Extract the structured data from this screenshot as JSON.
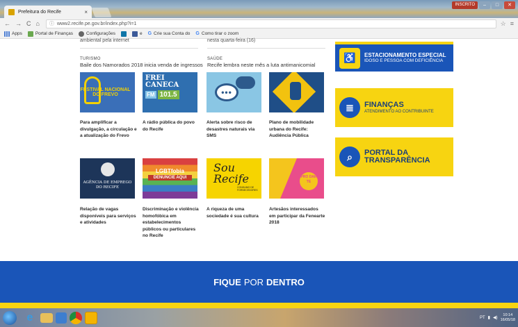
{
  "browser": {
    "tab_title": "Prefeitura do Recife",
    "tab_close": "×",
    "user_label": "INSCRITO",
    "nav_back": "←",
    "nav_forward": "→",
    "nav_reload": "C",
    "nav_home": "⌂",
    "url": "www2.recife.pe.gov.br/index.php?i=1",
    "info_glyph": "ⓘ",
    "star_glyph": "☆",
    "menu_glyph": "≡"
  },
  "bookmarks": [
    {
      "label": "Apps"
    },
    {
      "label": "Portal de Finanças"
    },
    {
      "label": "Configurações"
    },
    {
      "label": "in"
    },
    {
      "label": "e"
    },
    {
      "label": "Crie sua Conta do"
    },
    {
      "label": "Como tirar o zoom"
    }
  ],
  "page": {
    "cutoff_left": "ambiental pela internet",
    "cutoff_mid": "nesta quarta-feira (16)",
    "sections": [
      {
        "category": "TURISMO",
        "title": "Baile dos Namorados 2018 inicia venda de ingressos"
      },
      {
        "category": "SAÚDE",
        "title": "Recife lembra neste mês a luta antimanicomial"
      }
    ],
    "cards": [
      {
        "caption": "Para amplificar a divulgação, a circulação e a atualização do Frevo",
        "img_text": "FESTIVAL NACIONAL DO FREVO"
      },
      {
        "caption": "A rádio pública do povo do Recife",
        "img_t1": "FREI",
        "img_t2": "CANECA",
        "img_fm": "FM",
        "img_freq": "101.5"
      },
      {
        "caption": "Alerta sobre risco de desastres naturais via SMS",
        "img_text": "•••"
      },
      {
        "caption": "Plano de mobilidade urbana do Recife: Audiência Pública"
      },
      {
        "caption": "Relação de vagas disponíveis para serviços e atividades",
        "img_text": "AGÊNCIA DE EMPREGO DO RECIFE"
      },
      {
        "caption": "Discriminação e violência homofóbica em estabelecimentos públicos ou particulares no Recife",
        "img_t1": "LGBTfobia",
        "img_t2": "DENUNCIE AQUI"
      },
      {
        "caption": "A riqueza de uma sociedade é sua cultura",
        "img_t1": "Sou",
        "img_t2": "Recife",
        "img_sub": "CONSUMO DE FORNECEDORES"
      },
      {
        "caption": "Artesãos interessados em participar da Fenearte 2018",
        "img_text": "PRO DAR TE"
      }
    ],
    "banners": [
      {
        "title": "ESTACIONAMENTO ESPECIAL",
        "subtitle": "IDOSO E PESSOA COM DEFICIÊNCIA",
        "icon": "wheelchair-icon",
        "icon_glyph": "♿"
      },
      {
        "title": "FINANÇAS",
        "subtitle": "ATENDIMENTO AO CONTRIBUINTE",
        "icon": "coins-icon",
        "icon_glyph": "≣"
      },
      {
        "title": "PORTAL DA TRANSPARÊNCIA",
        "subtitle": "",
        "icon": "search-icon",
        "icon_glyph": "⌕"
      }
    ],
    "fique": {
      "word1": "FIQUE",
      "word2": "POR",
      "word3": "DENTRO"
    }
  },
  "taskbar": {
    "lang": "PT",
    "time": "10:14",
    "date": "16/05/18"
  },
  "colors": {
    "brand_blue": "#1a55b8",
    "brand_yellow": "#f7d411"
  }
}
